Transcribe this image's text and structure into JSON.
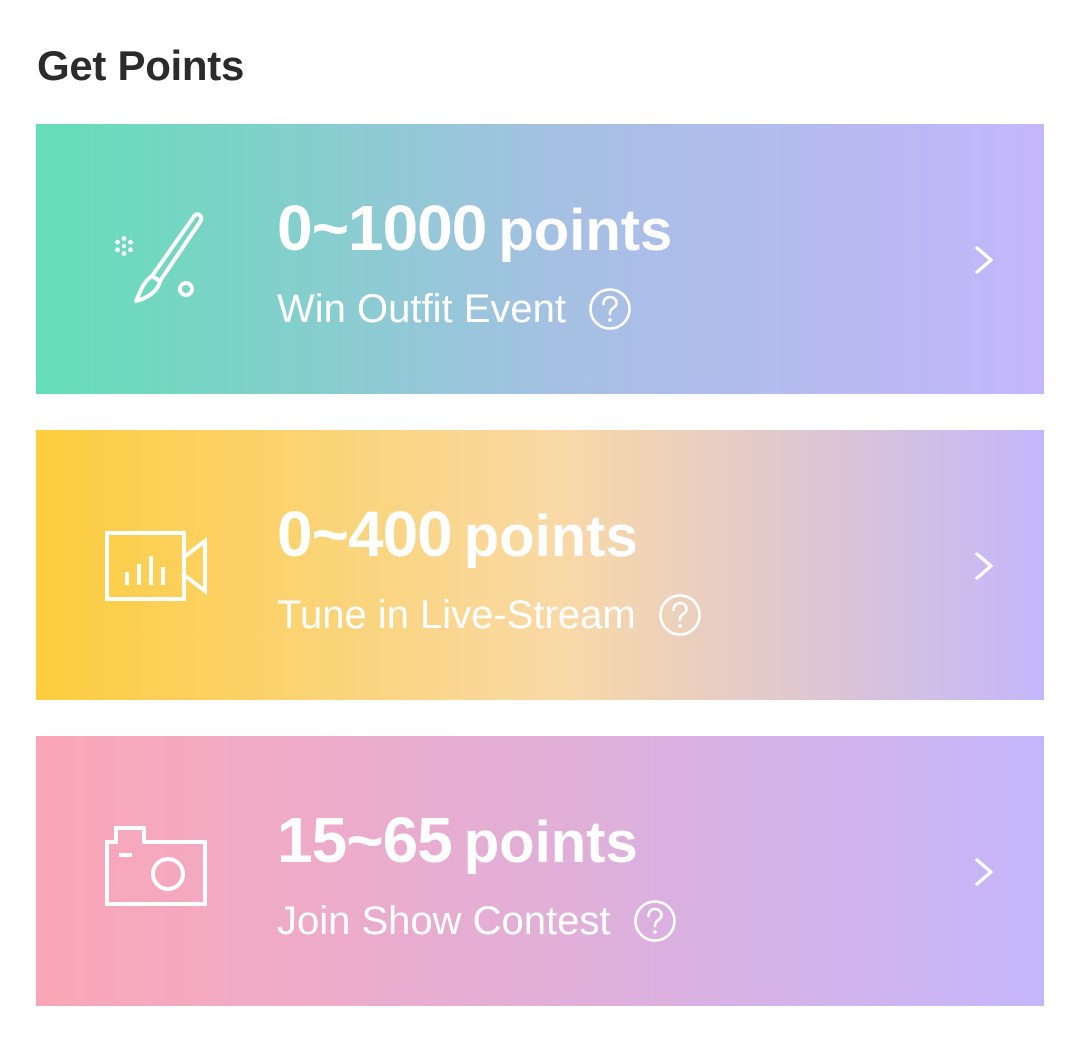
{
  "section": {
    "title": "Get Points"
  },
  "cards": [
    {
      "icon": "paintbrush-icon",
      "points_value": "0~1000",
      "points_unit": "points",
      "description": "Win Outfit Event",
      "help_icon": "question-circle-icon",
      "chevron_icon": "chevron-right-icon",
      "gradient": [
        "#63deb6",
        "#a5c0e3",
        "#c4b6fb"
      ]
    },
    {
      "icon": "video-camera-icon",
      "points_value": "0~400",
      "points_unit": "points",
      "description": "Tune in Live-Stream",
      "help_icon": "question-circle-icon",
      "chevron_icon": "chevron-right-icon",
      "gradient": [
        "#fdcd3d",
        "#f9d9a6",
        "#c4b6fb"
      ]
    },
    {
      "icon": "camera-icon",
      "points_value": "15~65",
      "points_unit": "points",
      "description": "Join Show Contest",
      "help_icon": "question-circle-icon",
      "chevron_icon": "chevron-right-icon",
      "gradient": [
        "#fba6b6",
        "#e1afd8",
        "#c4b6fb"
      ]
    }
  ],
  "colors": {
    "title_text": "#2b2b2b",
    "card_text": "#ffffff",
    "background": "#ffffff"
  }
}
